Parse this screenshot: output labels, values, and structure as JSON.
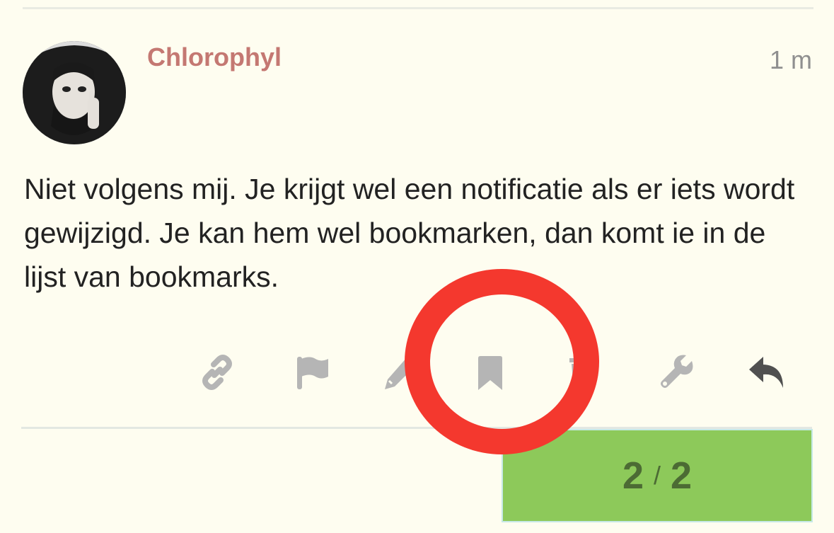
{
  "post": {
    "username": "Chlorophyl",
    "age": "1 m",
    "body": "Niet volgens mij. Je krijgt wel een notificatie als er iets wordt gewijzigd. Je kan hem wel bookmarken, dan komt ie in de lijst van bookmarks."
  },
  "actions": {
    "icons": [
      "link-icon",
      "flag-icon",
      "pencil-icon",
      "bookmark-icon",
      "trash-icon",
      "wrench-icon",
      "reply-icon"
    ],
    "icon_color": "#b5b5b5",
    "reply_color": "#505050"
  },
  "progress": {
    "current": "2",
    "separator": "/",
    "total": "2",
    "fraction": 1.0,
    "color": "#8dc95a"
  },
  "annotation": {
    "ring_color": "#f4382e",
    "target": "bookmark-icon"
  }
}
